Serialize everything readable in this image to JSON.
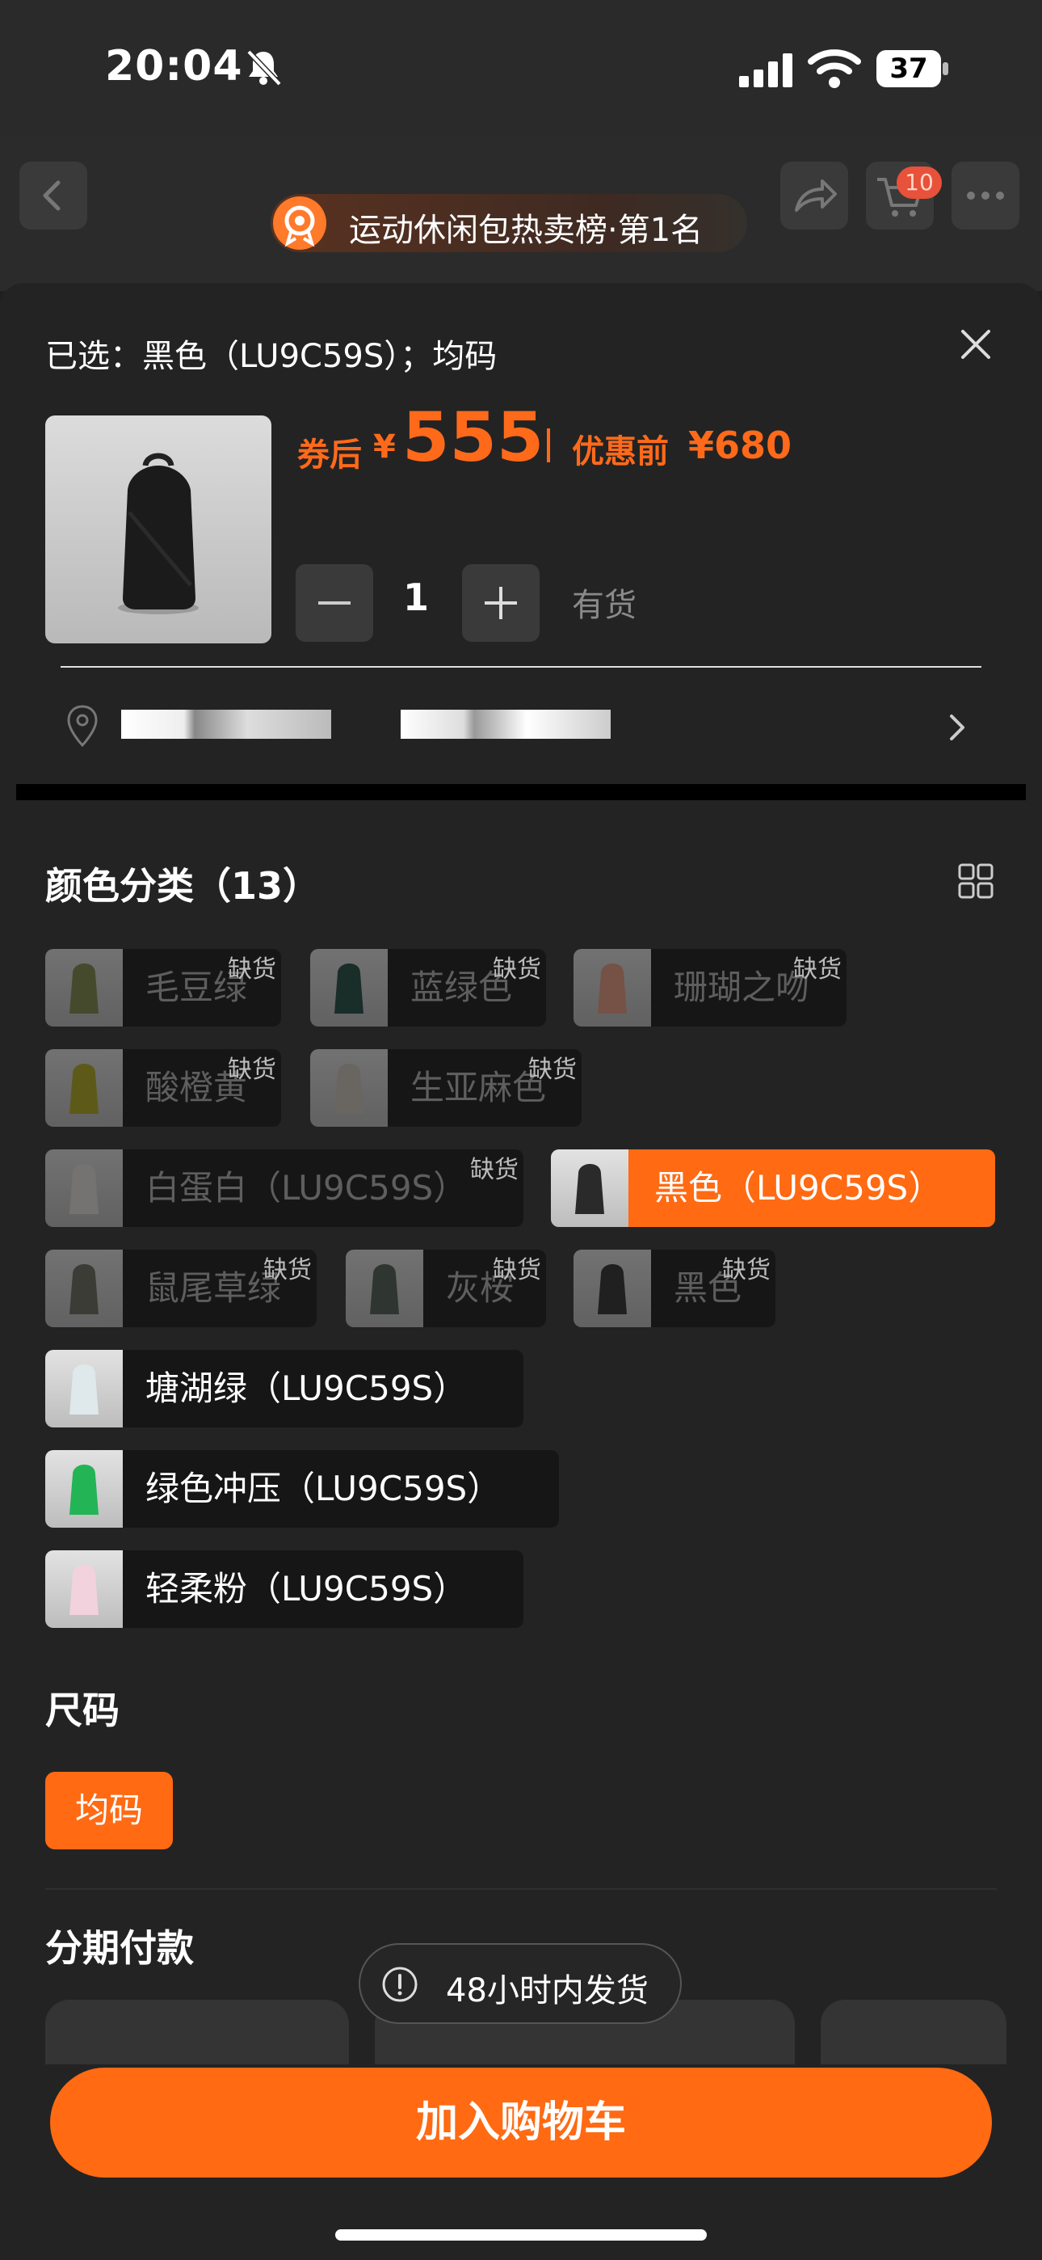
{
  "status_bar": {
    "time": "20:04",
    "battery": "37"
  },
  "nav": {
    "rank_badge": "运动休闲包热卖榜·第1名",
    "cart_count": "10"
  },
  "sheet": {
    "selected_text": "已选：黑色（LU9C59S）；均码",
    "price": {
      "after_coupon_label": "券后",
      "currency": "¥",
      "after_coupon_value": "555",
      "before_discount_label": "优惠前",
      "before_discount_value": "¥680"
    },
    "quantity": {
      "value": "1",
      "stock_status": "有货"
    }
  },
  "colors_section": {
    "title": "颜色分类（13）",
    "out_of_stock_label": "缺货",
    "options": [
      {
        "label": "毛豆绿",
        "out_of_stock": true,
        "swatch": "#7f8a4a"
      },
      {
        "label": "蓝绿色",
        "out_of_stock": true,
        "swatch": "#1e4a40"
      },
      {
        "label": "珊瑚之吻",
        "out_of_stock": true,
        "swatch": "#e89a80"
      },
      {
        "label": "酸橙黄",
        "out_of_stock": true,
        "swatch": "#b4ae1e"
      },
      {
        "label": "生亚麻色",
        "out_of_stock": false,
        "swatch": "#cfc8bc"
      },
      {
        "label": "白蛋白（LU9C59S）",
        "out_of_stock": true,
        "swatch": "#e8e4e0"
      },
      {
        "label": "黑色（LU9C59S）",
        "out_of_stock": false,
        "selected": true,
        "swatch": "#2a2a2a"
      },
      {
        "label": "鼠尾草绿",
        "out_of_stock": true,
        "swatch": "#6a6a5e"
      },
      {
        "label": "灰桉",
        "out_of_stock": true,
        "swatch": "#4e5e52"
      },
      {
        "label": "黑色",
        "out_of_stock": true,
        "swatch": "#2e2e2e"
      },
      {
        "label": "塘湖绿（LU9C59S）",
        "out_of_stock": false,
        "swatch": "#dfe8ea"
      },
      {
        "label": "绿色冲压（LU9C59S）",
        "out_of_stock": false,
        "swatch": "#22b455"
      },
      {
        "label": "轻柔粉（LU9C59S）",
        "out_of_stock": false,
        "swatch": "#f2d2dc"
      }
    ]
  },
  "size_section": {
    "title": "尺码",
    "selected": "均码"
  },
  "installment_section": {
    "title": "分期付款"
  },
  "toast": {
    "text": "48小时内发货"
  },
  "cta": {
    "label": "加入购物车"
  },
  "colors": {
    "accent": "#ff6a13",
    "background": "#232323"
  }
}
